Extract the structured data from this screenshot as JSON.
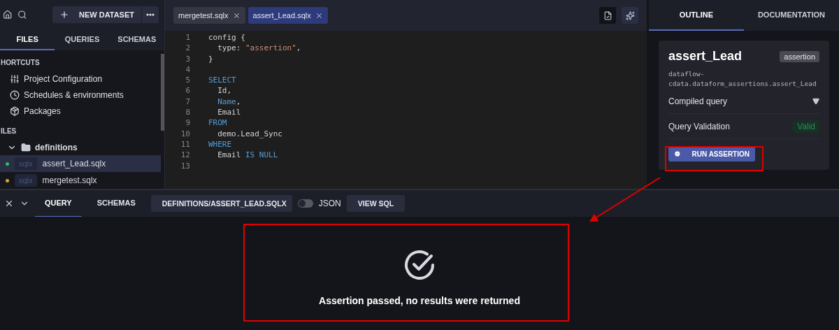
{
  "header": {
    "new_dataset": "NEW DATASET"
  },
  "sidebar": {
    "tabs": [
      {
        "label": "FILES",
        "selected": true
      },
      {
        "label": "QUERIES",
        "selected": false
      },
      {
        "label": "SCHEMAS",
        "selected": false
      }
    ],
    "shortcuts_title": "HORTCUTS",
    "shortcuts": [
      {
        "kind": "config",
        "label": "Project Configuration"
      },
      {
        "kind": "schedule",
        "label": "Schedules & environments"
      },
      {
        "kind": "package",
        "label": "Packages"
      }
    ],
    "files_title": "ILES",
    "folder": {
      "label": "definitions",
      "expanded": true,
      "children": [
        {
          "ext": "sqlx",
          "label": "assert_Lead.sqlx",
          "selected": true,
          "color": "#2fbf5a"
        },
        {
          "ext": "sqlx",
          "label": "mergetest.sqlx",
          "selected": false,
          "color": "#d9a13a"
        }
      ]
    }
  },
  "editor": {
    "tabs": [
      {
        "label": "mergetest.sqlx",
        "selected": false
      },
      {
        "label": "assert_Lead.sqlx",
        "selected": true
      }
    ],
    "lines": [
      {
        "number": "1",
        "tokens": [
          {
            "kind": "plain",
            "text": "config {"
          }
        ]
      },
      {
        "number": "2",
        "tokens": [
          {
            "kind": "plain",
            "text": "  type: "
          },
          {
            "kind": "string",
            "text": "\"assertion\""
          },
          {
            "kind": "plain",
            "text": ","
          }
        ]
      },
      {
        "number": "3",
        "tokens": [
          {
            "kind": "plain",
            "text": "}"
          }
        ]
      },
      {
        "number": "4"
      },
      {
        "number": "5",
        "tokens": [
          {
            "kind": "keyword",
            "text": "SELECT"
          }
        ]
      },
      {
        "number": "6",
        "tokens": [
          {
            "kind": "plain",
            "text": "  Id,"
          }
        ]
      },
      {
        "number": "7",
        "tokens": [
          {
            "kind": "keyword",
            "text": "  Name"
          },
          {
            "kind": "plain",
            "text": ","
          }
        ]
      },
      {
        "number": "8",
        "tokens": [
          {
            "kind": "plain",
            "text": "  Email"
          }
        ]
      },
      {
        "number": "9",
        "tokens": [
          {
            "kind": "keyword",
            "text": "FROM"
          }
        ]
      },
      {
        "number": "10",
        "tokens": [
          {
            "kind": "plain",
            "text": "  demo.Lead_Sync"
          }
        ]
      },
      {
        "number": "11",
        "tokens": [
          {
            "kind": "keyword",
            "text": "WHERE"
          }
        ]
      },
      {
        "number": "12",
        "tokens": [
          {
            "kind": "plain",
            "text": "  Email "
          },
          {
            "kind": "keyword",
            "text": "IS NULL"
          }
        ]
      },
      {
        "number": "13"
      }
    ]
  },
  "outline": {
    "tabs": [
      {
        "label": "OUTLINE",
        "selected": true
      },
      {
        "label": "DOCUMENTATION",
        "selected": false
      }
    ],
    "name": "assert_Lead",
    "type_badge": "assertion",
    "path": "dataflow-\ncdata.dataform_assertions.assert_Lead",
    "compiled_query": "Compiled query",
    "validation_label": "Query Validation",
    "validation_status": "Valid",
    "run_button": "RUN ASSERTION"
  },
  "bottom": {
    "tabs": [
      {
        "label": "QUERY",
        "selected": true
      },
      {
        "label": "SCHEMAS",
        "selected": false
      }
    ],
    "file_select": "DEFINITIONS/ASSERT_LEAD.SQLX",
    "json_toggle": {
      "label": "JSON",
      "on": false
    },
    "view_sql": "VIEW SQL",
    "result": "Assertion passed, no results were returned"
  }
}
